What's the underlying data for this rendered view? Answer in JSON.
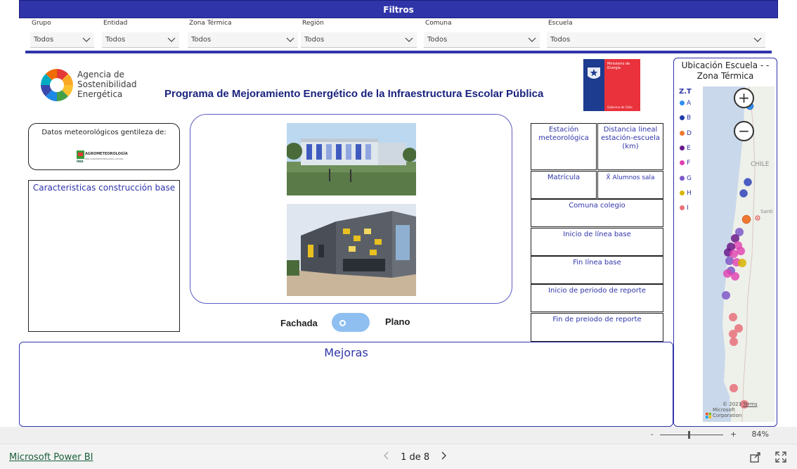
{
  "filters": {
    "title": "Filtros",
    "items": [
      {
        "label": "Grupo",
        "value": "Todos"
      },
      {
        "label": "Entidad",
        "value": "Todos"
      },
      {
        "label": "Zona Térmica",
        "value": "Todos"
      },
      {
        "label": "Región",
        "value": "Todos"
      },
      {
        "label": "Comuna",
        "value": "Todos"
      },
      {
        "label": "Escuela",
        "value": "Todos"
      }
    ]
  },
  "header": {
    "agency_logo": {
      "line1": "Agencia de",
      "line2": "Sostenibilidad",
      "line3": "Energética"
    },
    "title": "Programa de Mejoramiento Energético de la Infraestructura Escolar Pública",
    "ministry_logo": {
      "line1": "Ministerio de",
      "line2": "Energía",
      "footer": "Gobierno de Chile"
    }
  },
  "meteo_credit": {
    "text": "Datos meteorológicos gentileza de:",
    "logo_name": "AGROMETEOROLOGÍA",
    "logo_sub": "RED AGROMETEOROLÓGICA DE INIA",
    "logo_mark": "INIA"
  },
  "characteristics": {
    "title": "Caracteristicas construcción base"
  },
  "toggle": {
    "left_label": "Fachada",
    "right_label": "Plano"
  },
  "info_grid": {
    "estacion": "Estación meteorológica",
    "distancia": "Distancia lineal estación-escuela (km)",
    "matricula": "Matrícula",
    "alumnos": "X̄ Alumnos sala",
    "comuna": "Comuna colegio",
    "inicio_linea": "Inicio de línea base",
    "fin_linea": "Fin línea base",
    "inicio_reporte": "Inicio de periodo de reporte",
    "fin_reporte": "Fin de preiodo de reporte"
  },
  "mejoras": {
    "title": "Mejoras"
  },
  "map": {
    "title": "Ubicación Escuela - -Zona Térmica",
    "legend_title": "Z.T",
    "legend": [
      {
        "label": "A",
        "color": "#2f8ff0"
      },
      {
        "label": "B",
        "color": "#1f3aa8"
      },
      {
        "label": "D",
        "color": "#f07830"
      },
      {
        "label": "E",
        "color": "#6a1a8a"
      },
      {
        "label": "F",
        "color": "#e040b0"
      },
      {
        "label": "G",
        "color": "#7e58c8"
      },
      {
        "label": "H",
        "color": "#d8b400"
      },
      {
        "label": "I",
        "color": "#e8707a"
      }
    ],
    "country_label": "CHILE",
    "city_label": "Santi",
    "attribution_year": "© 2023",
    "attribution_corp": "Microsoft Corporation",
    "terms": "Terms"
  },
  "status": {
    "zoom": "84%",
    "minus": "-",
    "plus": "+"
  },
  "footer": {
    "brand": "Microsoft Power BI",
    "page": "1 de 8"
  }
}
